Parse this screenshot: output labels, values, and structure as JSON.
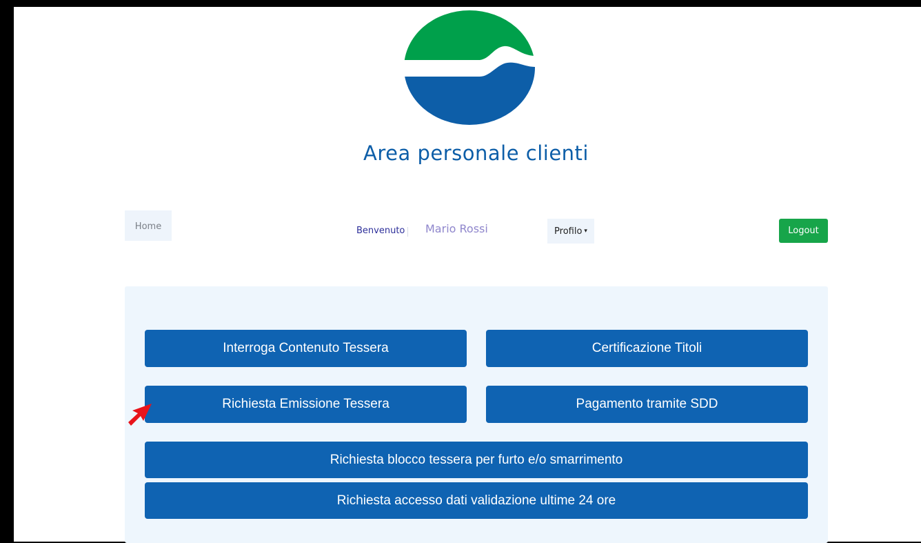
{
  "header": {
    "title": "Area personale clienti"
  },
  "nav": {
    "home_label": "Home",
    "welcome_label": "Benvenuto",
    "user_name": "Mario Rossi",
    "profile_label": "Profilo",
    "logout_label": "Logout"
  },
  "actions": [
    {
      "label": "Interroga Contenuto Tessera"
    },
    {
      "label": "Certificazione Titoli"
    },
    {
      "label": "Richiesta Emissione Tessera"
    },
    {
      "label": "Pagamento tramite SDD"
    },
    {
      "label": "Richiesta blocco tessera per furto e/o smarrimento"
    },
    {
      "label": "Richiesta accesso dati validazione ultime 24 ore"
    }
  ],
  "icons": {
    "logo": "company-logo",
    "pointer": "red-arrow-pointer-icon",
    "caret": "caret-down-icon"
  },
  "colors": {
    "brand_blue": "#0f63b2",
    "brand_green": "#00a04b",
    "logout_green": "#17a54a",
    "panel_bg": "#eef6fd",
    "pointer_red": "#e8141b"
  }
}
